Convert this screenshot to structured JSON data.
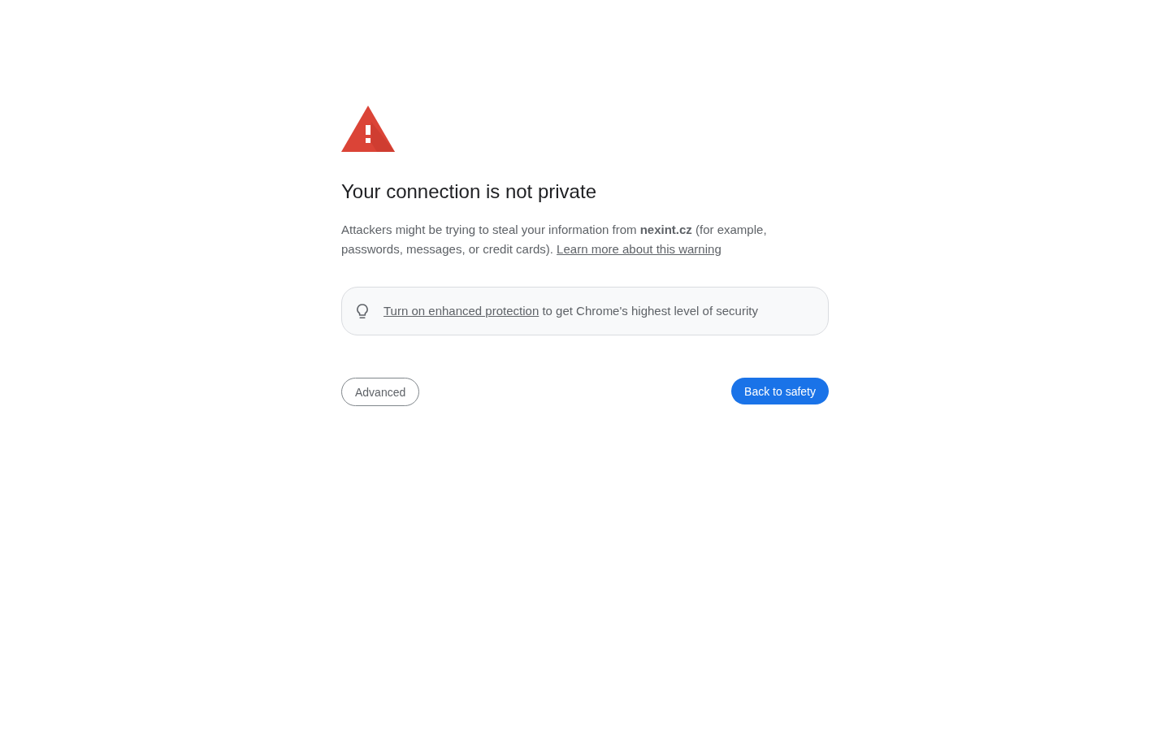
{
  "heading": "Your connection is not private",
  "description": {
    "text": "Attackers might be trying to steal your information from **nexint.cz** (for example, passwords, messages, or credit cards).",
    "link": "Learn more about this warning"
  },
  "protection_banner": {
    "link": "Turn on enhanced protection",
    "text": "to get Chrome's highest level of security"
  },
  "buttons": [
    {
      "label": "Advanced",
      "kind": "secondary"
    },
    {
      "label": "Back to safety",
      "kind": "primary"
    }
  ]
}
